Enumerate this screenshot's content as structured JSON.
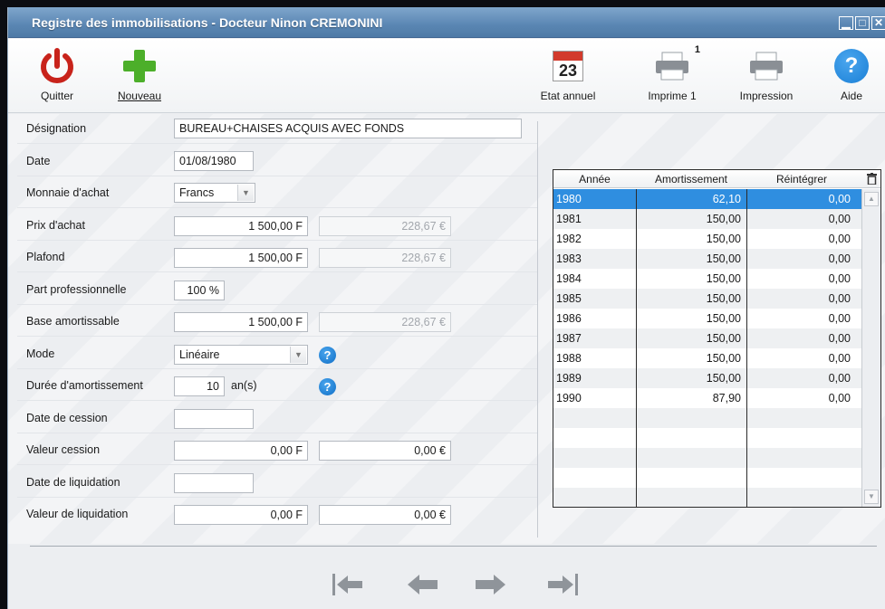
{
  "window": {
    "title": "Registre des immobilisations - Docteur Ninon CREMONINI",
    "controls": [
      "minimize",
      "restore",
      "close"
    ]
  },
  "toolbar": {
    "quit_label": "Quitter",
    "new_label": "Nouveau",
    "annual_label": "Etat annuel",
    "calendar_day": "23",
    "print1_label": "Imprime 1",
    "print1_badge": "1",
    "print_label": "Impression",
    "help_label": "Aide"
  },
  "form": {
    "designation": {
      "label": "Désignation",
      "value": "BUREAU+CHAISES ACQUIS AVEC FONDS"
    },
    "date": {
      "label": "Date",
      "value": "01/08/1980"
    },
    "currency": {
      "label": "Monnaie d'achat",
      "value": "Francs"
    },
    "purchase_price": {
      "label": "Prix d'achat",
      "value_f": "1 500,00 F",
      "value_e": "228,67 €"
    },
    "ceiling": {
      "label": "Plafond",
      "value_f": "1 500,00 F",
      "value_e": "228,67 €"
    },
    "pro_share": {
      "label": "Part professionnelle",
      "value": "100 %"
    },
    "base": {
      "label": "Base amortissable",
      "value_f": "1 500,00 F",
      "value_e": "228,67 €"
    },
    "mode": {
      "label": "Mode",
      "value": "Linéaire"
    },
    "duration": {
      "label": "Durée d'amortissement",
      "value": "10",
      "unit": "an(s)"
    },
    "sale_date": {
      "label": "Date de cession",
      "value": ""
    },
    "sale_value": {
      "label": "Valeur cession",
      "value_f": "0,00 F",
      "value_e": "0,00 €"
    },
    "liq_date": {
      "label": "Date de liquidation",
      "value": ""
    },
    "liq_value": {
      "label": "Valeur de liquidation",
      "value_f": "0,00 F",
      "value_e": "0,00 €"
    },
    "help_glyph": "?"
  },
  "table": {
    "headers": [
      "Année",
      "Amortissement",
      "Réintégrer"
    ],
    "selected_row": 0,
    "rows": [
      [
        "1980",
        "62,10",
        "0,00"
      ],
      [
        "1981",
        "150,00",
        "0,00"
      ],
      [
        "1982",
        "150,00",
        "0,00"
      ],
      [
        "1983",
        "150,00",
        "0,00"
      ],
      [
        "1984",
        "150,00",
        "0,00"
      ],
      [
        "1985",
        "150,00",
        "0,00"
      ],
      [
        "1986",
        "150,00",
        "0,00"
      ],
      [
        "1987",
        "150,00",
        "0,00"
      ],
      [
        "1988",
        "150,00",
        "0,00"
      ],
      [
        "1989",
        "150,00",
        "0,00"
      ],
      [
        "1990",
        "87,90",
        "0,00"
      ]
    ],
    "empty_rows": 5
  },
  "icons": {
    "quit": "power-icon",
    "new": "plus-icon",
    "annual": "calendar-icon",
    "print1": "printer-icon",
    "print": "printer-icon",
    "help": "question-icon",
    "nav": [
      "first-record-icon",
      "previous-record-icon",
      "next-record-icon",
      "last-record-icon"
    ]
  },
  "colors": {
    "titlebar": "#5a86b3",
    "selection": "#2f8ee0",
    "quit_red": "#c8231b",
    "new_green": "#4caf2a",
    "help_blue": "#1a7fd6",
    "nav_gray": "#8f949a"
  }
}
